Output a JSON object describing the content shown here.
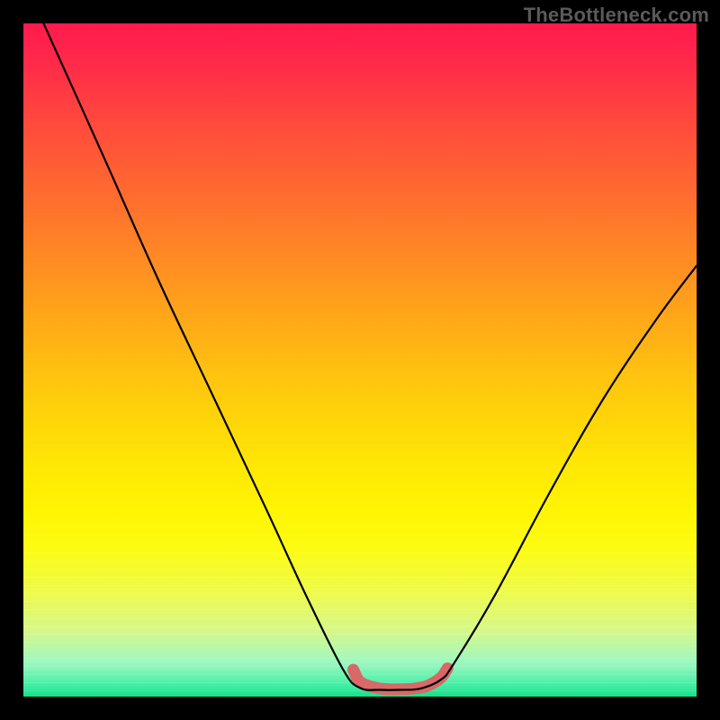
{
  "watermark": "TheBottleneck.com",
  "chart_data": {
    "type": "line",
    "title": "",
    "xlabel": "",
    "ylabel": "",
    "xlim": [
      0,
      100
    ],
    "ylim": [
      0,
      100
    ],
    "series": [
      {
        "name": "bottleneck-curve",
        "x": [
          3,
          12,
          20,
          28,
          36,
          42,
          47.5,
          50,
          53,
          56,
          59,
          62,
          64,
          70,
          78,
          86,
          94,
          100
        ],
        "values": [
          100,
          80,
          62,
          45,
          28,
          15,
          4,
          1.3,
          1.0,
          1.0,
          1.2,
          2.5,
          5,
          15,
          30,
          44,
          56,
          64
        ]
      },
      {
        "name": "sweet-spot-band",
        "x": [
          49,
          50,
          52,
          54,
          56,
          58,
          60,
          62,
          63
        ],
        "values": [
          4.0,
          2.2,
          1.4,
          1.1,
          1.1,
          1.2,
          1.6,
          2.8,
          4.2
        ]
      }
    ],
    "colors": {
      "curve": "#000000",
      "band": "#d96868"
    }
  }
}
